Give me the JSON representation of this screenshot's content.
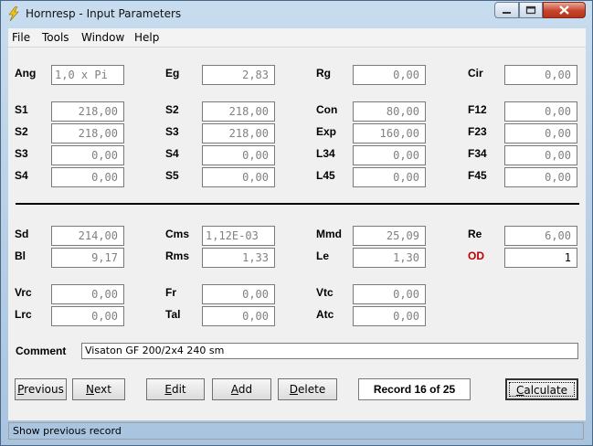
{
  "window": {
    "title": "Hornresp - Input Parameters"
  },
  "menu": [
    "File",
    "Tools",
    "Window",
    "Help"
  ],
  "params": [
    {
      "label": "Ang",
      "value": "1,0 x Pi"
    },
    {
      "label": "Eg",
      "value": "2,83"
    },
    {
      "label": "Rg",
      "value": "0,00"
    },
    {
      "label": "Cir",
      "value": "0,00"
    },
    {
      "label": "S1",
      "value": "218,00"
    },
    {
      "label": "S2",
      "value": "218,00"
    },
    {
      "label": "Con",
      "value": "80,00"
    },
    {
      "label": "F12",
      "value": "0,00"
    },
    {
      "label": "S2",
      "value": "218,00"
    },
    {
      "label": "S3",
      "value": "218,00"
    },
    {
      "label": "Exp",
      "value": "160,00"
    },
    {
      "label": "F23",
      "value": "0,00"
    },
    {
      "label": "S3",
      "value": "0,00"
    },
    {
      "label": "S4",
      "value": "0,00"
    },
    {
      "label": "L34",
      "value": "0,00"
    },
    {
      "label": "F34",
      "value": "0,00"
    },
    {
      "label": "S4",
      "value": "0,00"
    },
    {
      "label": "S5",
      "value": "0,00"
    },
    {
      "label": "L45",
      "value": "0,00"
    },
    {
      "label": "F45",
      "value": "0,00"
    },
    {
      "label": "Sd",
      "value": "214,00"
    },
    {
      "label": "Cms",
      "value": "1,12E-03"
    },
    {
      "label": "Mmd",
      "value": "25,09"
    },
    {
      "label": "Re",
      "value": "6,00"
    },
    {
      "label": "Bl",
      "value": "9,17"
    },
    {
      "label": "Rms",
      "value": "1,33"
    },
    {
      "label": "Le",
      "value": "1,30"
    },
    {
      "label": "OD",
      "value": "1"
    },
    {
      "label": "Vrc",
      "value": "0,00"
    },
    {
      "label": "Fr",
      "value": "0,00"
    },
    {
      "label": "Vtc",
      "value": "0,00"
    },
    {
      "label": "Lrc",
      "value": "0,00"
    },
    {
      "label": "Tal",
      "value": "0,00"
    },
    {
      "label": "Atc",
      "value": "0,00"
    }
  ],
  "comment": {
    "label": "Comment",
    "value": "Visaton GF 200/2x4 240 sm"
  },
  "buttons": {
    "previous": {
      "lead": "P",
      "rest": "revious"
    },
    "next": {
      "lead": "N",
      "rest": "ext"
    },
    "edit": {
      "lead": "E",
      "rest": "dit"
    },
    "add": {
      "lead": "A",
      "rest": "dd"
    },
    "delete": {
      "lead": "D",
      "rest": "elete"
    },
    "calculate": {
      "lead": "C",
      "rest": "alculate"
    }
  },
  "record": "Record 16 of 25",
  "status": "Show previous record",
  "colors": {
    "accent_label": "#c00000",
    "close_button": "#c7432b"
  }
}
